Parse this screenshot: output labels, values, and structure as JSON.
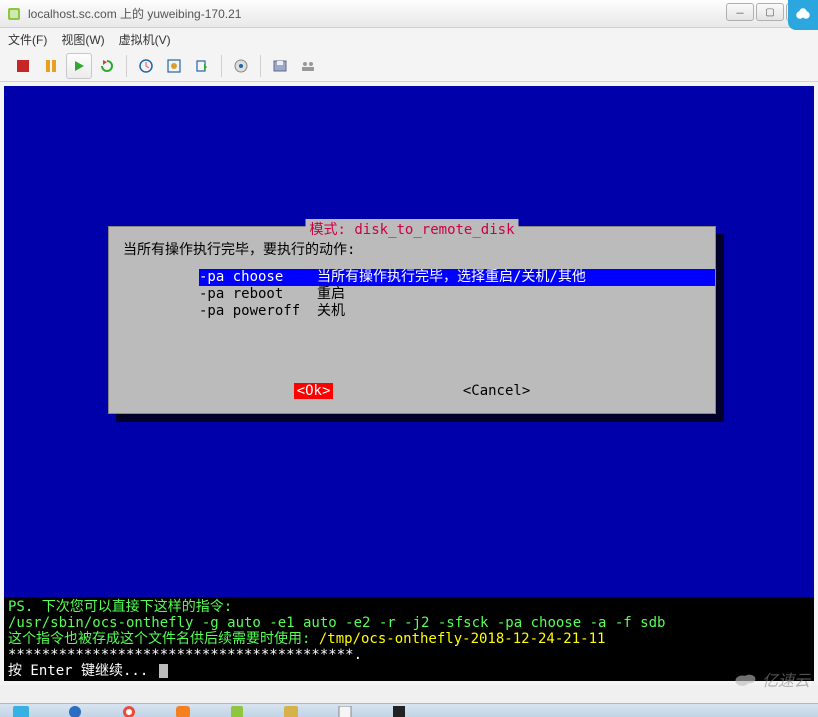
{
  "titlebar": {
    "text": "localhost.sc.com 上的 yuweibing-170.21"
  },
  "menubar": {
    "file": "文件(F)",
    "view": "视图(W)",
    "vm": "虚拟机(V)"
  },
  "dialog": {
    "title": "模式: disk_to_remote_disk",
    "prompt": "当所有操作执行完毕，要执行的动作:",
    "options": [
      {
        "opt": "-pa choose",
        "desc": "当所有操作执行完毕，选择重启/关机/其他"
      },
      {
        "opt": "-pa reboot",
        "desc": "重启"
      },
      {
        "opt": "-pa poweroff",
        "desc": "关机"
      }
    ],
    "ok": "<Ok>",
    "cancel": "<Cancel>"
  },
  "term": {
    "ps": "PS. 下次您可以直接下这样的指令:",
    "cmd": "/usr/sbin/ocs-onthefly -g auto -e1 auto -e2 -r -j2 -sfsck -pa choose -a -f sdb",
    "saved_prefix": "这个指令也被存成这个文件名供后续需要时使用: ",
    "saved_path": "/tmp/ocs-onthefly-2018-12-24-21-11",
    "stars": "*****************************************.",
    "enter": "按 Enter 键继续...  "
  },
  "watermark": "亿速云"
}
